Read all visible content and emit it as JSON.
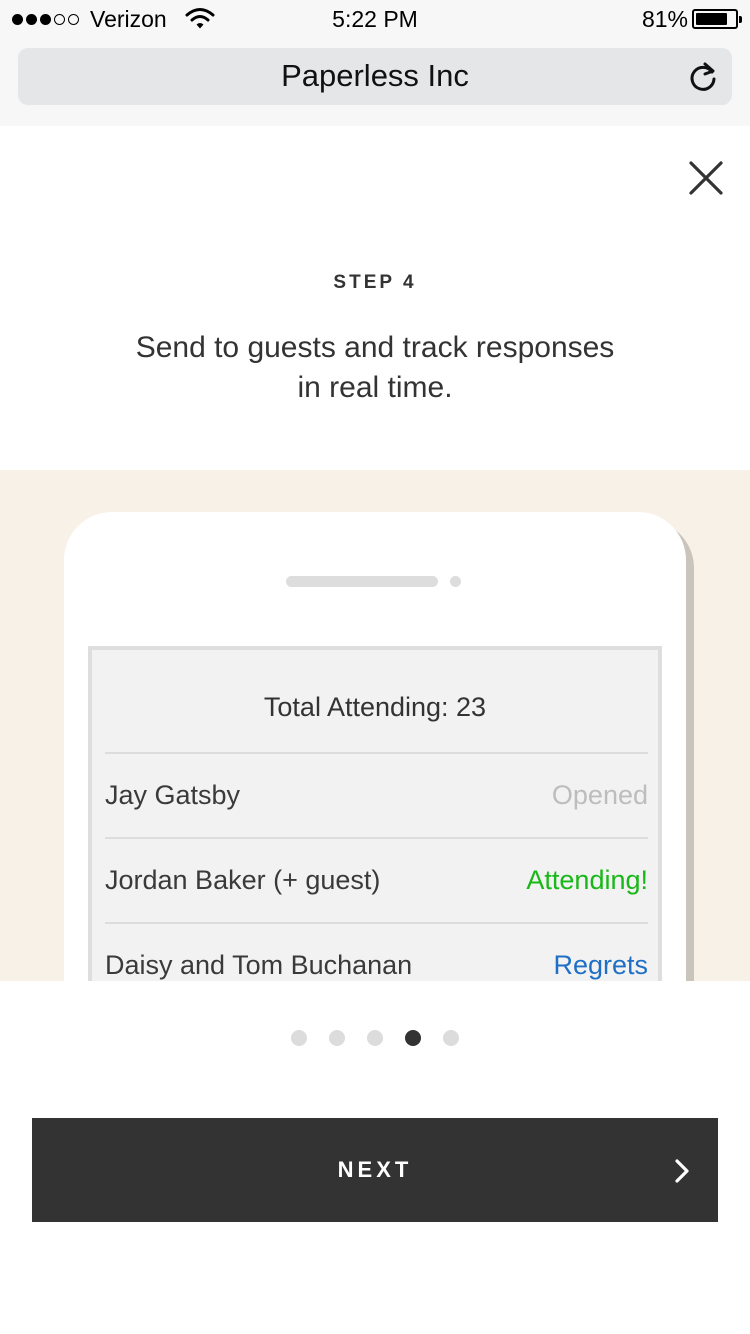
{
  "status_bar": {
    "carrier": "Verizon",
    "signal_bars_filled": 3,
    "signal_bars_total": 5,
    "time": "5:22 PM",
    "battery_percent": "81%",
    "battery_level": 0.81,
    "wifi_icon": "wifi-icon",
    "battery_icon": "battery-icon"
  },
  "browser": {
    "page_title": "Paperless Inc",
    "reload_icon": "reload-icon"
  },
  "onboarding": {
    "close_icon": "close-icon",
    "step_label": "STEP 4",
    "description": "Send to guests and track responses in real time."
  },
  "illustration": {
    "background_color": "#f7f1e8",
    "total_attending": "Total Attending: 23",
    "guests": [
      {
        "name": "Jay Gatsby",
        "status": "Opened",
        "status_color": "#bdbdbd"
      },
      {
        "name": "Jordan Baker (+ guest)",
        "status": "Attending!",
        "status_color": "#17b817"
      },
      {
        "name": "Daisy and Tom Buchanan",
        "status": "Regrets",
        "status_color": "#1f6fc6"
      }
    ]
  },
  "pagination": {
    "total": 5,
    "active_index": 3
  },
  "next_button": {
    "label": "NEXT",
    "icon": "chevron-right-icon",
    "color": "#333333"
  }
}
